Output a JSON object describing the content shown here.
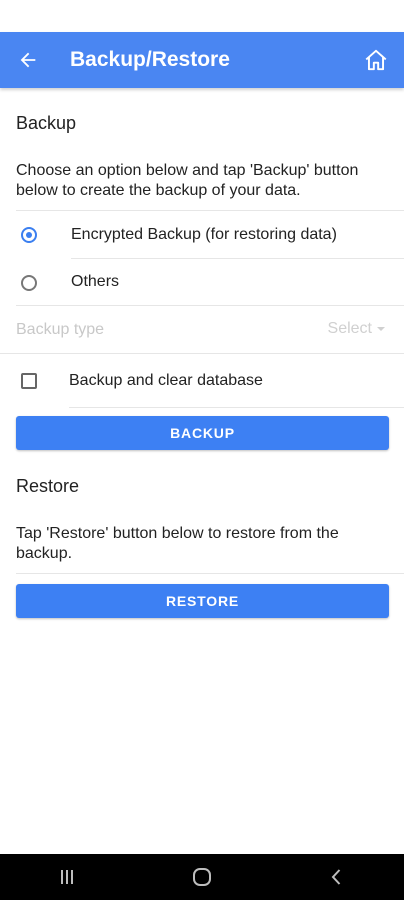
{
  "appbar": {
    "title": "Backup/Restore",
    "back_icon": "arrow-left-icon",
    "home_icon": "home-icon",
    "color": "#4a86f2"
  },
  "backup": {
    "title": "Backup",
    "description": "Choose an option below and tap 'Backup' button below to create the backup of your data.",
    "options": [
      {
        "label": "Encrypted Backup (for restoring data)",
        "selected": true
      },
      {
        "label": "Others",
        "selected": false
      }
    ],
    "backup_type": {
      "label": "Backup type",
      "value": "Select"
    },
    "clear_database": {
      "label": "Backup and clear database",
      "checked": false
    },
    "button_label": "BACKUP"
  },
  "restore": {
    "title": "Restore",
    "description": "Tap 'Restore' button below to restore from the backup.",
    "button_label": "RESTORE"
  },
  "colors": {
    "accent": "#3d80f3",
    "placeholder": "#c8c8c8"
  },
  "system_nav": {
    "icons": [
      "recent-apps-icon",
      "home-nav-icon",
      "back-nav-icon"
    ]
  }
}
